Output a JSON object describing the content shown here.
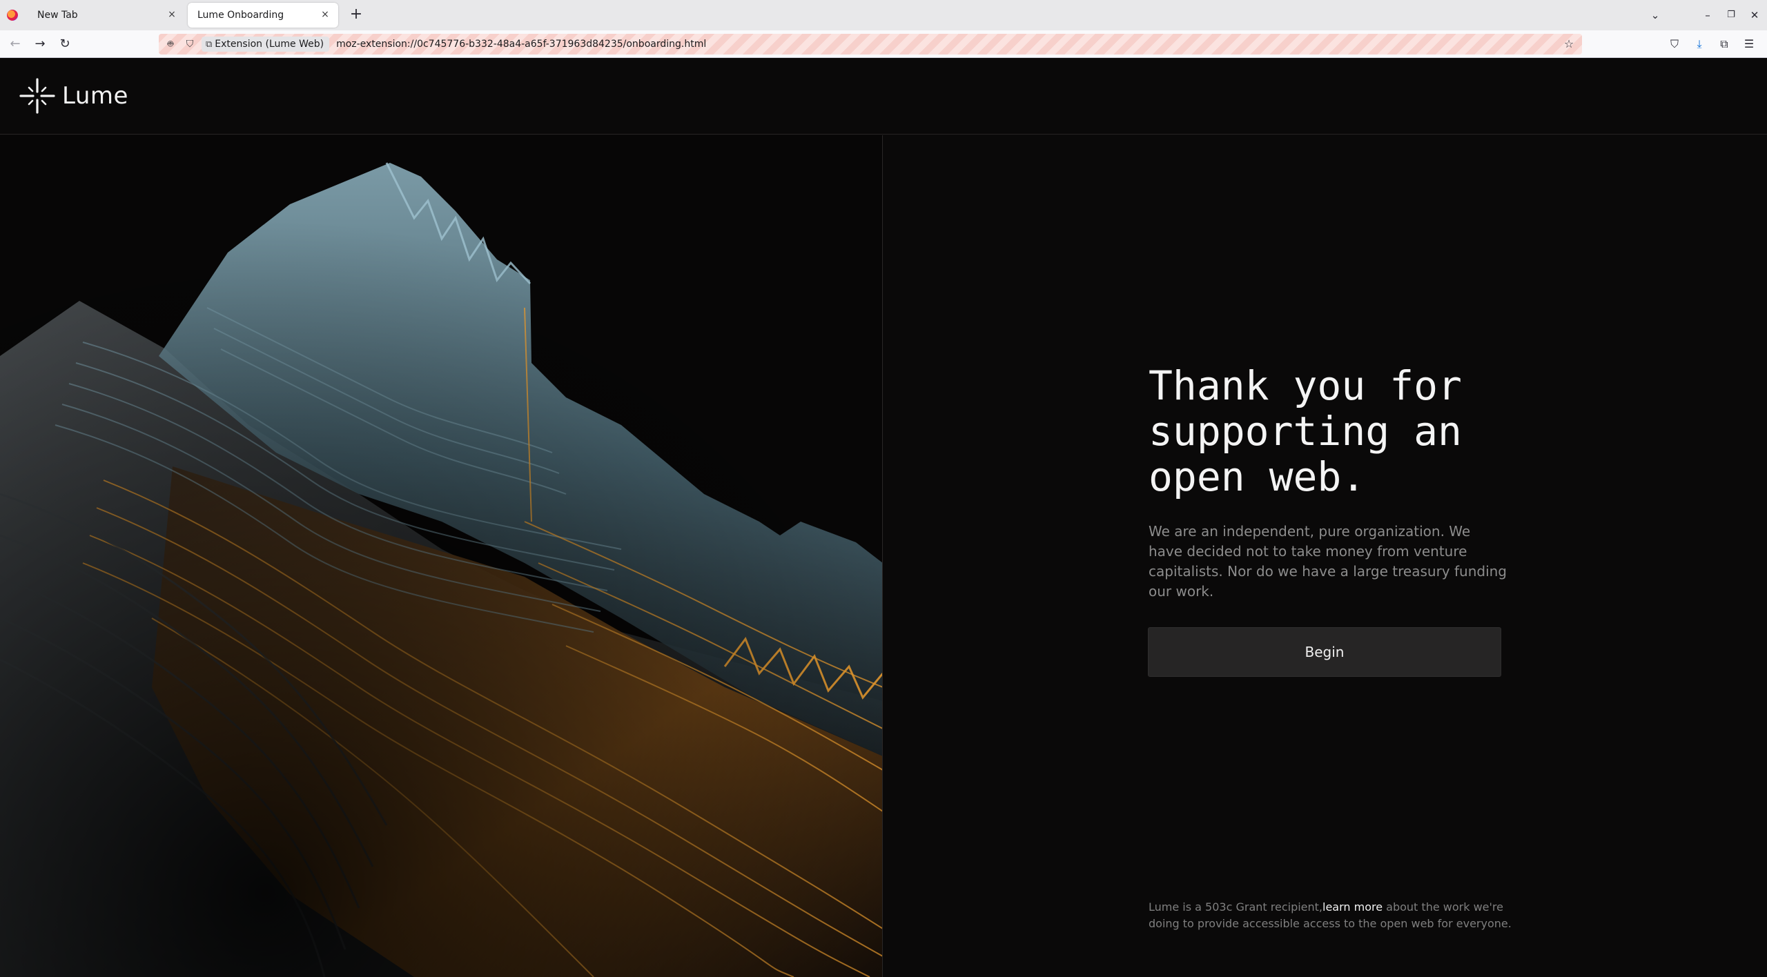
{
  "browser": {
    "tabs": [
      {
        "label": "New Tab",
        "active": false
      },
      {
        "label": "Lume Onboarding",
        "active": true
      }
    ],
    "new_tab_symbol": "+",
    "close_symbol": "×",
    "url": "moz-extension://0c745776-b332-48a4-a65f-371963d84235/onboarding.html",
    "identity_label": "Extension (Lume Web)",
    "icons": {
      "back": "back-arrow-icon",
      "forward": "forward-arrow-icon",
      "reload": "reload-icon",
      "bookmark": "star-icon",
      "pocket": "pocket-icon",
      "downloads": "download-icon",
      "extensions": "puzzle-icon",
      "menu": "hamburger-menu-icon"
    },
    "window_controls": [
      "tab-list",
      "minimize",
      "restore",
      "close"
    ]
  },
  "site": {
    "brand": "Lume",
    "colors": {
      "background": "#0a0909",
      "button": "#262525",
      "accent_orange": "#f0a030",
      "accent_teal": "#6e98a8"
    }
  },
  "hero": {
    "headline": "Thank you for\nsupporting an\nopen web.",
    "body": "We are an independent, pure organization. We have decided not to take money from venture capitalists. Nor do we have a large treasury funding our work.",
    "cta_label": "Begin",
    "footnote_prefix": "Lume is a 503c Grant recipient,",
    "footnote_link": "learn more",
    "footnote_suffix": " about the work we're doing to provide accessible access to the open web for everyone."
  }
}
